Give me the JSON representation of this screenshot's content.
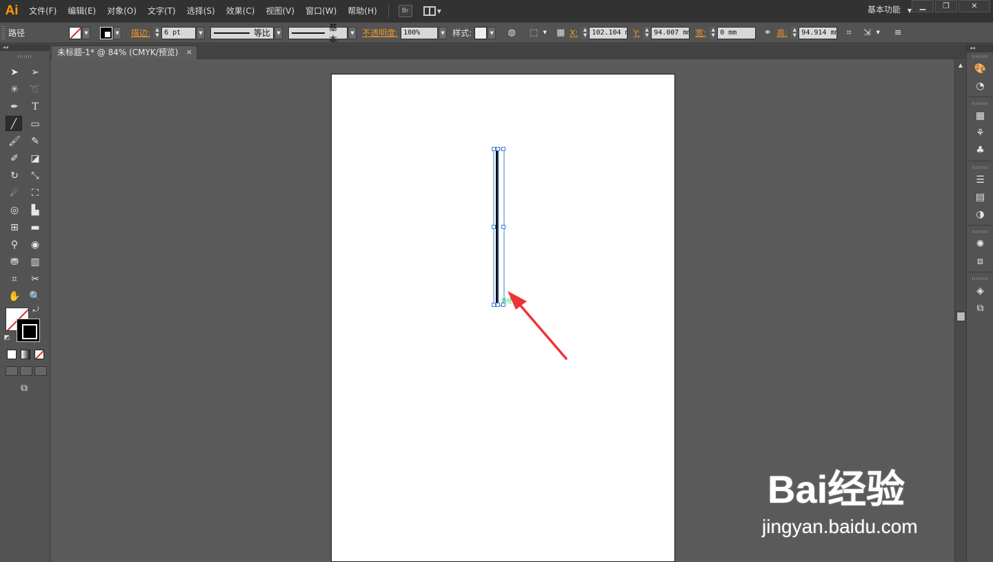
{
  "app": {
    "logo": "Ai",
    "menu": [
      "文件(F)",
      "编辑(E)",
      "对象(O)",
      "文字(T)",
      "选择(S)",
      "效果(C)",
      "视图(V)",
      "窗口(W)",
      "帮助(H)"
    ],
    "bridge_label": "Br",
    "workspace": "基本功能",
    "workspace_icon": "chevron-down-icon",
    "window_controls": [
      "minimize-icon",
      "restore-icon",
      "close-icon"
    ]
  },
  "control_bar": {
    "selection_type": "路径",
    "stroke_label": "描边:",
    "stroke_weight": "6 pt",
    "variable_width_profile": "等比",
    "brush": "基本",
    "opacity_label": "不透明度:",
    "opacity": "100%",
    "style_label": "样式:",
    "x_label": "X:",
    "x_value": "102.104 m",
    "y_label": "Y:",
    "y_value": "94.007 mm",
    "width_label": "宽:",
    "width_value": "0 mm",
    "height_label": "高:",
    "height_value": "94.914 mm"
  },
  "document_tab": {
    "title": "未标题-1* @ 84% (CMYK/预览)",
    "close": "×"
  },
  "toolbar": {
    "tools": [
      "selection-tool-icon",
      "direct-selection-tool-icon",
      "magic-wand-tool-icon",
      "lasso-tool-icon",
      "pen-tool-icon",
      "type-tool-icon",
      "line-segment-tool-icon",
      "rectangle-tool-icon",
      "paintbrush-tool-icon",
      "pencil-tool-icon",
      "blob-brush-tool-icon",
      "eraser-tool-icon",
      "rotate-tool-icon",
      "scale-tool-icon",
      "warp-tool-icon",
      "free-transform-tool-icon",
      "shape-builder-tool-icon",
      "perspective-grid-tool-icon",
      "mesh-tool-icon",
      "gradient-tool-icon",
      "eyedropper-tool-icon",
      "blend-tool-icon",
      "symbol-sprayer-tool-icon",
      "column-graph-tool-icon",
      "artboard-tool-icon",
      "slice-tool-icon",
      "hand-tool-icon",
      "zoom-tool-icon"
    ],
    "active_tool": "line-segment-tool-icon",
    "fill": "none",
    "stroke_color": "#000000"
  },
  "canvas": {
    "artboard_color": "#ffffff",
    "path_stroke_color": "#000000",
    "selection_color": "#3a7bd5",
    "annotation_arrow_color": "#ee3338",
    "smart_guide_text": "路径"
  },
  "right_panels": [
    "color-panel-icon",
    "color-guide-icon",
    "swatches-panel-icon",
    "brushes-panel-icon",
    "symbols-panel-icon",
    "stroke-panel-icon",
    "gradient-panel-icon",
    "transparency-panel-icon",
    "appearance-panel-icon",
    "graphic-styles-icon",
    "layers-panel-icon",
    "artboards-panel-icon"
  ],
  "watermark": {
    "brand": "Bai经验",
    "url": "jingyan.baidu.com"
  }
}
